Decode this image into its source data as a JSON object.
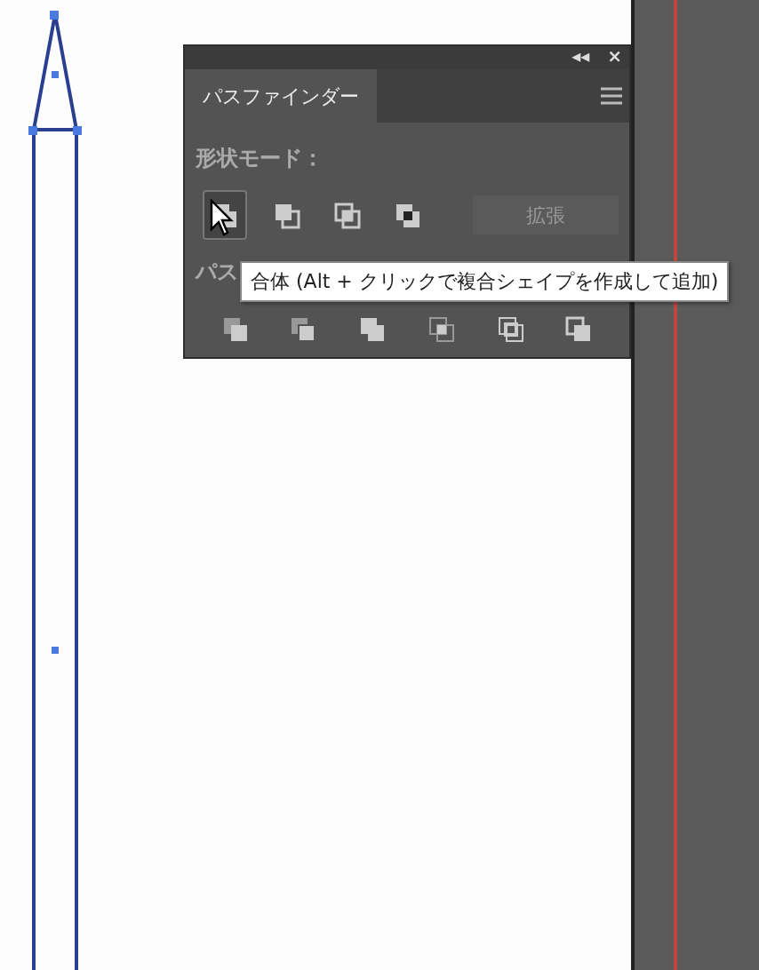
{
  "panel": {
    "collapse_glyph": "◂◂",
    "close_glyph": "×",
    "tab": {
      "label": "パスファインダー",
      "selected": true
    },
    "shape_modes_label": "形状モード：",
    "shape_modes": [
      {
        "hover": true
      },
      {
        "hover": false
      },
      {
        "hover": false
      },
      {
        "hover": false
      }
    ],
    "expand_button": {
      "label": "拡張",
      "disabled": true
    },
    "pathfinders_label": "パス",
    "tooltip": "合体 (Alt + クリックで複合シェイプを作成して追加)"
  }
}
